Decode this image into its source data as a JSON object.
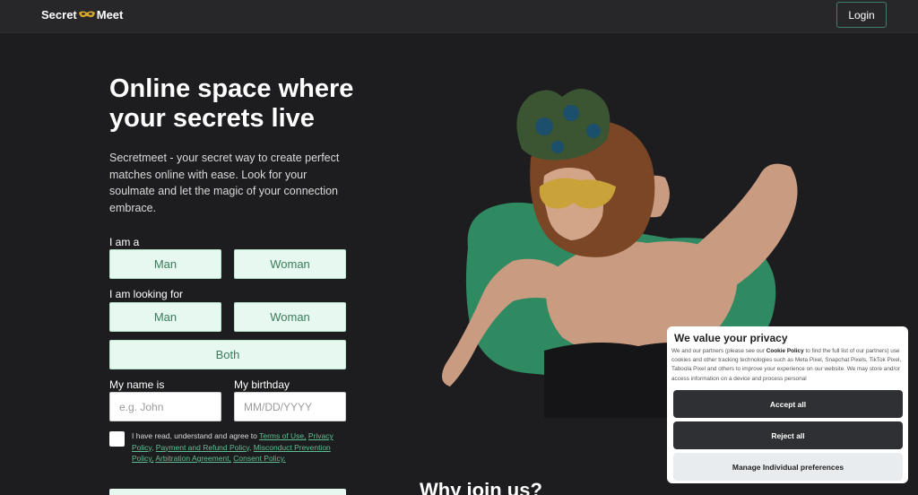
{
  "header": {
    "logo_left": "Secret",
    "logo_right": "Meet",
    "login_label": "Login"
  },
  "hero": {
    "title": "Online space where your secrets live",
    "description": "Secretmeet - your secret way to create perfect matches online with ease. Look for your soulmate and let the magic of your connection embrace."
  },
  "form": {
    "i_am_label": "I am a",
    "i_am_options": [
      "Man",
      "Woman"
    ],
    "looking_for_label": "I am looking for",
    "looking_for_options": [
      "Man",
      "Woman",
      "Both"
    ],
    "name_label": "My name is",
    "name_placeholder": "e.g. John",
    "birthday_label": "My birthday",
    "birthday_placeholder": "MM/DD/YYYY",
    "agree_prefix": "I have read, understand and agree to ",
    "agree_links": [
      "Terms of Use,",
      "Privacy Policy,",
      "Payment and Refund Policy,",
      "Misconduct Prevention Policy,",
      "Arbitration Agreement,",
      "Consent Policy."
    ]
  },
  "section": {
    "why_title": "Why join us?"
  },
  "cookie": {
    "title": "We value your privacy",
    "text_before": "We and our partners (please see our ",
    "policy_link": "Cookie Policy",
    "text_after": " to find the full list of our partners) use cookies and other tracking technologies such as Meta Pixel, Snapchat Pixels, TikTok Pixel, Taboola Pixel and others to improve your experience on our website. We may store and/or access information on a device and process personal",
    "accept_label": "Accept all",
    "reject_label": "Reject all",
    "manage_label": "Manage Individual preferences"
  },
  "colors": {
    "background": "#1d1d1f",
    "accent_green": "#2f8a62",
    "choice_bg": "#e6f8ef",
    "choice_text": "#3a7d5c"
  }
}
